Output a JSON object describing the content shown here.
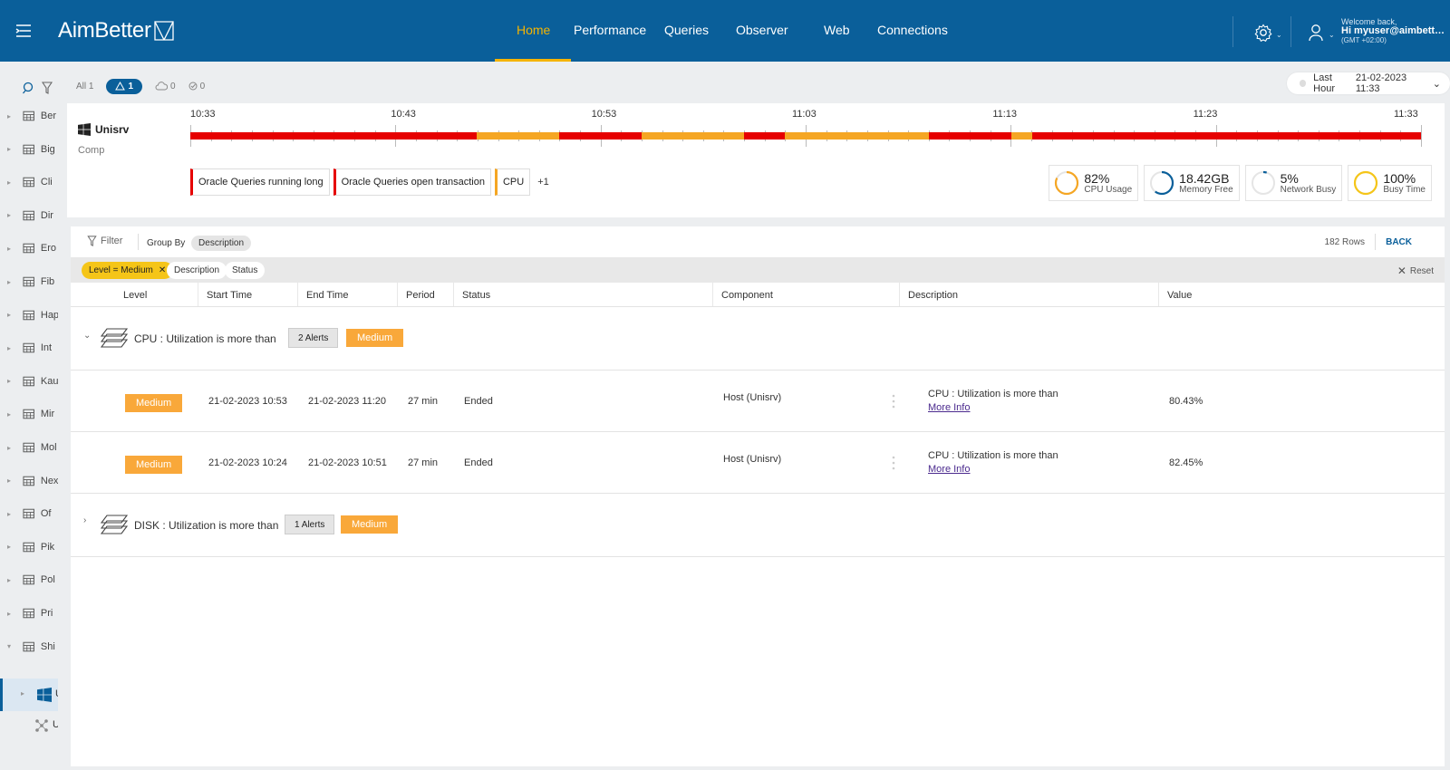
{
  "header": {
    "logo_text": "AimBetter",
    "nav": [
      {
        "label": "Home",
        "active": true
      },
      {
        "label": "Performance"
      },
      {
        "label": "Queries"
      },
      {
        "label": "Observer"
      },
      {
        "label": "Web"
      },
      {
        "label": "Connections"
      }
    ],
    "welcome_line": "Welcome back,",
    "user_line": "Hi myuser@aimbetter...",
    "timezone": "(GMT +02:00)",
    "colors": {
      "bar": "#0a5f9a",
      "accent": "#f5b400"
    }
  },
  "sidebar": {
    "items": [
      {
        "label": "Ber"
      },
      {
        "label": "Big"
      },
      {
        "label": "Cli"
      },
      {
        "label": "Dir"
      },
      {
        "label": "Ero"
      },
      {
        "label": "Fib"
      },
      {
        "label": "Hap"
      },
      {
        "label": "Int"
      },
      {
        "label": "Kau"
      },
      {
        "label": "Mir"
      },
      {
        "label": "Mol"
      },
      {
        "label": "Nex"
      },
      {
        "label": "Of"
      },
      {
        "label": "Pik"
      },
      {
        "label": "Pol"
      },
      {
        "label": "Pri"
      },
      {
        "label": "Shi"
      }
    ],
    "selected_child": "U",
    "second_child": "U"
  },
  "counts": {
    "all": "All 1",
    "alerts": "1",
    "cloud": "0",
    "check": "0"
  },
  "time_range": {
    "label": "Last Hour",
    "datetime": "21-02-2023 11:33"
  },
  "host": {
    "name": "Unisrv",
    "subtitle": "Comp",
    "timeline_labels": [
      "10:33",
      "10:43",
      "10:53",
      "11:03",
      "11:13",
      "11:23",
      "11:33"
    ],
    "timeline_segments": [
      {
        "status": "red",
        "fraction": 0.233
      },
      {
        "status": "orange",
        "fraction": 0.067
      },
      {
        "status": "red",
        "fraction": 0.067
      },
      {
        "status": "orange",
        "fraction": 0.083
      },
      {
        "status": "red",
        "fraction": 0.033
      },
      {
        "status": "orange",
        "fraction": 0.117
      },
      {
        "status": "red",
        "fraction": 0.067
      },
      {
        "status": "orange",
        "fraction": 0.017
      },
      {
        "status": "red",
        "fraction": 0.316
      }
    ],
    "status_colors": {
      "red": "#e60000",
      "orange": "#f5a623"
    },
    "tags": [
      {
        "label": "Oracle Queries running long",
        "level": "red"
      },
      {
        "label": "Oracle Queries open transaction",
        "level": "red"
      },
      {
        "label": "CPU",
        "level": "orange"
      }
    ],
    "tags_more": "+1",
    "metrics": [
      {
        "value": "82%",
        "caption": "CPU Usage",
        "color": "#f5a623",
        "fill": 0.82
      },
      {
        "value": "18.42GB",
        "caption": "Memory Free",
        "color": "#0a5f9a",
        "fill": 0.6
      },
      {
        "value": "5%",
        "caption": "Network Busy",
        "color": "#0a5f9a",
        "fill": 0.05
      },
      {
        "value": "100%",
        "caption": "Busy Time",
        "color": "#f5c518",
        "fill": 1.0
      }
    ]
  },
  "toolbar": {
    "filter_label": "Filter",
    "group_by_label": "Group By",
    "group_by_value": "Description",
    "rows": "182 Rows",
    "back": "BACK"
  },
  "active_filters": {
    "chips": [
      "Level = Medium",
      "Description",
      "Status"
    ],
    "reset": "Reset"
  },
  "table": {
    "headers": [
      "Level",
      "Start Time",
      "End Time",
      "Period",
      "Status",
      "Component",
      "Description",
      "Value"
    ],
    "groups": [
      {
        "title": "CPU : Utilization is more than",
        "count": "2 Alerts",
        "level": "Medium",
        "expanded": true,
        "rows": [
          {
            "level": "Medium",
            "start": "21-02-2023 10:53",
            "end": "21-02-2023 11:20",
            "period": "27 min",
            "status": "Ended",
            "component": "Host (Unisrv)",
            "description": "CPU : Utilization is more than",
            "more": "More Info",
            "value": "80.43%"
          },
          {
            "level": "Medium",
            "start": "21-02-2023 10:24",
            "end": "21-02-2023 10:51",
            "period": "27 min",
            "status": "Ended",
            "component": "Host (Unisrv)",
            "description": "CPU : Utilization is more than",
            "more": "More Info",
            "value": "82.45%"
          }
        ]
      },
      {
        "title": "DISK : Utilization is more than",
        "count": "1 Alerts",
        "level": "Medium",
        "expanded": false,
        "rows": []
      }
    ]
  }
}
